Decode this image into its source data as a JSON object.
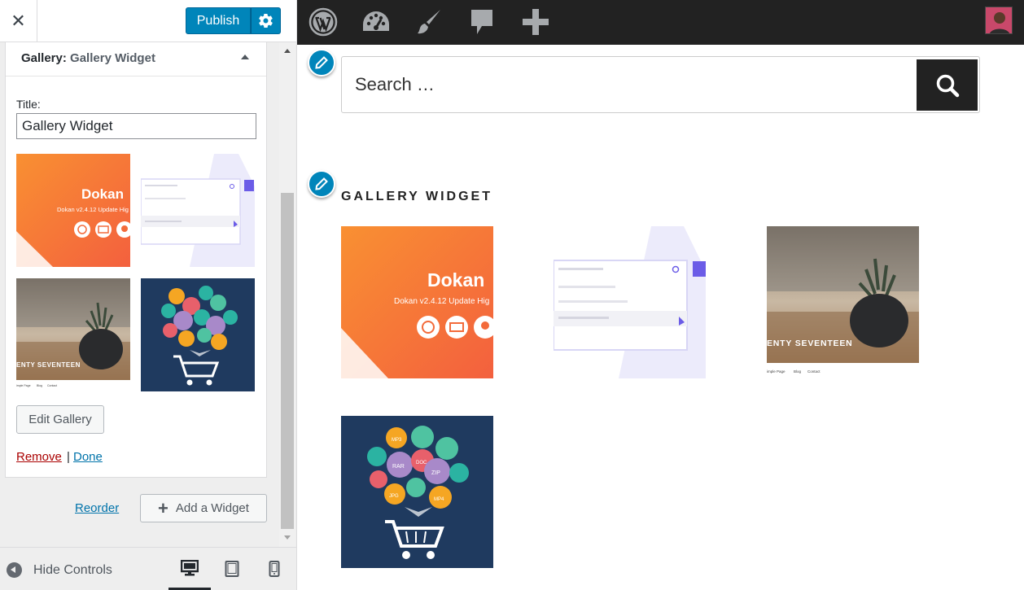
{
  "header": {
    "close_icon": "close-icon",
    "publish_label": "Publish",
    "settings_icon": "gear-icon"
  },
  "widget": {
    "name": "Gallery",
    "sep": ":",
    "instance_title": "Gallery Widget",
    "title_label": "Title:",
    "title_value": "Gallery Widget",
    "edit_gallery_label": "Edit Gallery",
    "remove_label": "Remove",
    "separator": "|",
    "done_label": "Done"
  },
  "gallery_images": [
    {
      "kind": "dokan-banner",
      "caption": "Dokan",
      "subcaption": "Dokan v2.4.12 Update Hig"
    },
    {
      "kind": "search-ui"
    },
    {
      "kind": "plant-photo",
      "caption": "ENTY SEVENTEEN",
      "menu": [
        "imple Page",
        "Blog",
        "Contact"
      ]
    },
    {
      "kind": "file-cart"
    }
  ],
  "panel_actions": {
    "reorder_label": "Reorder",
    "add_widget_label": "Add a Widget"
  },
  "footer": {
    "hide_controls_label": "Hide Controls",
    "devices": [
      "desktop",
      "tablet",
      "mobile"
    ]
  },
  "adminbar": {
    "items": [
      "wordpress-icon",
      "customize-icon",
      "brush-icon",
      "comments-icon",
      "plus-icon"
    ]
  },
  "preview": {
    "search_placeholder": "Search …",
    "gallery_heading": "GALLERY WIDGET",
    "file_badges": [
      "MP3",
      "DOC",
      "RAR",
      "ZIP",
      "MP4",
      "JPG"
    ]
  },
  "colors": {
    "accent": "#0085ba",
    "adminbar": "#222222",
    "remove": "#aa0000",
    "link": "#0073aa",
    "dokan_orange": "#f26d36",
    "navy": "#1f3a5f"
  }
}
